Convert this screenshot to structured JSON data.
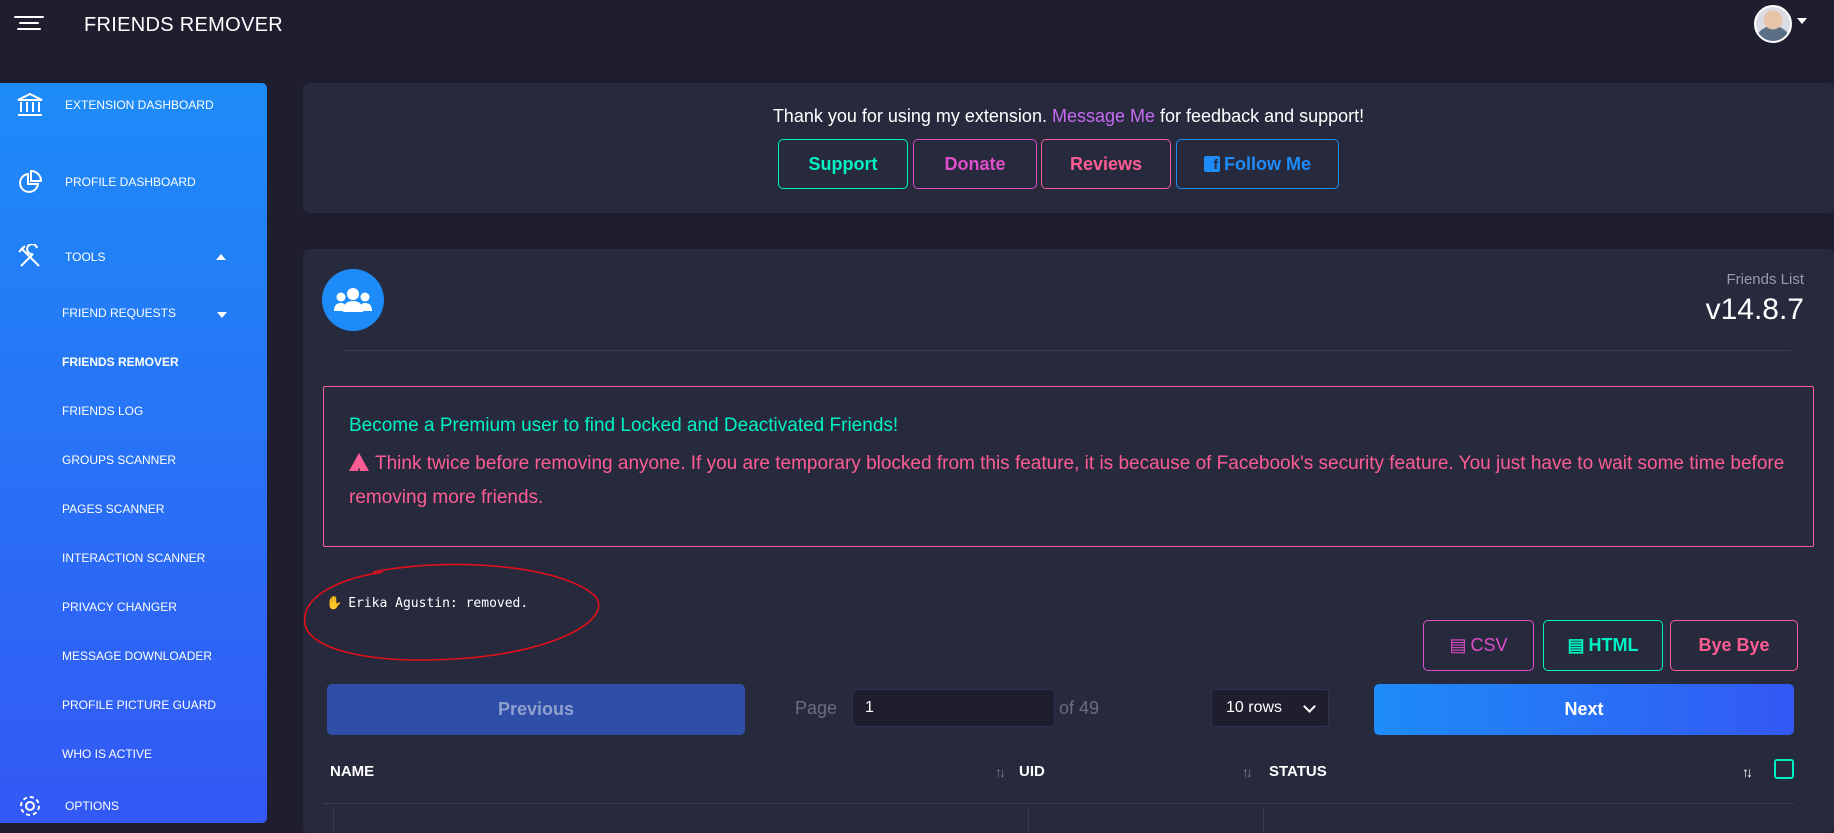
{
  "header": {
    "title": "FRIENDS REMOVER"
  },
  "sidebar": {
    "items": [
      {
        "label": "EXTENSION DASHBOARD"
      },
      {
        "label": "PROFILE DASHBOARD"
      },
      {
        "label": "TOOLS"
      }
    ],
    "tools": [
      {
        "label": "FRIEND REQUESTS"
      },
      {
        "label": "FRIENDS REMOVER",
        "active": true
      },
      {
        "label": "FRIENDS LOG"
      },
      {
        "label": "GROUPS SCANNER"
      },
      {
        "label": "PAGES SCANNER"
      },
      {
        "label": "INTERACTION SCANNER"
      },
      {
        "label": "PRIVACY CHANGER"
      },
      {
        "label": "MESSAGE DOWNLOADER"
      },
      {
        "label": "PROFILE PICTURE GUARD"
      },
      {
        "label": "WHO IS ACTIVE"
      }
    ],
    "options_label": "OPTIONS"
  },
  "banner": {
    "text_before": "Thank you for using my extension.",
    "link": "Message Me",
    "text_after": "for feedback and support!",
    "buttons": {
      "support": "Support",
      "donate": "Donate",
      "reviews": "Reviews",
      "follow": "Follow Me"
    }
  },
  "friends": {
    "list_label": "Friends List",
    "version": "v14.8.7",
    "alert_premium": "Become a Premium user to find Locked and Deactivated Friends!",
    "alert_warning": "Think twice before removing anyone. If you are temporary blocked from this feature, it is because of Facebook's security feature. You just have to wait some time before removing more friends.",
    "log_message": "Erika Agustin: removed.",
    "export": {
      "csv": "CSV",
      "html": "HTML",
      "bye": "Bye Bye"
    },
    "pagination": {
      "previous": "Previous",
      "page_label": "Page",
      "page_value": "1",
      "of_label": "of 49",
      "rows": "10 rows",
      "next": "Next"
    },
    "table": {
      "columns": [
        "NAME",
        "UID",
        "STATUS"
      ]
    }
  },
  "colors": {
    "accent_blue": "#1d8cf8",
    "teal": "#00f2c3",
    "pink": "#fd5d93",
    "purple": "#e14eca",
    "card": "#27293d",
    "background": "#1e1e2f"
  }
}
